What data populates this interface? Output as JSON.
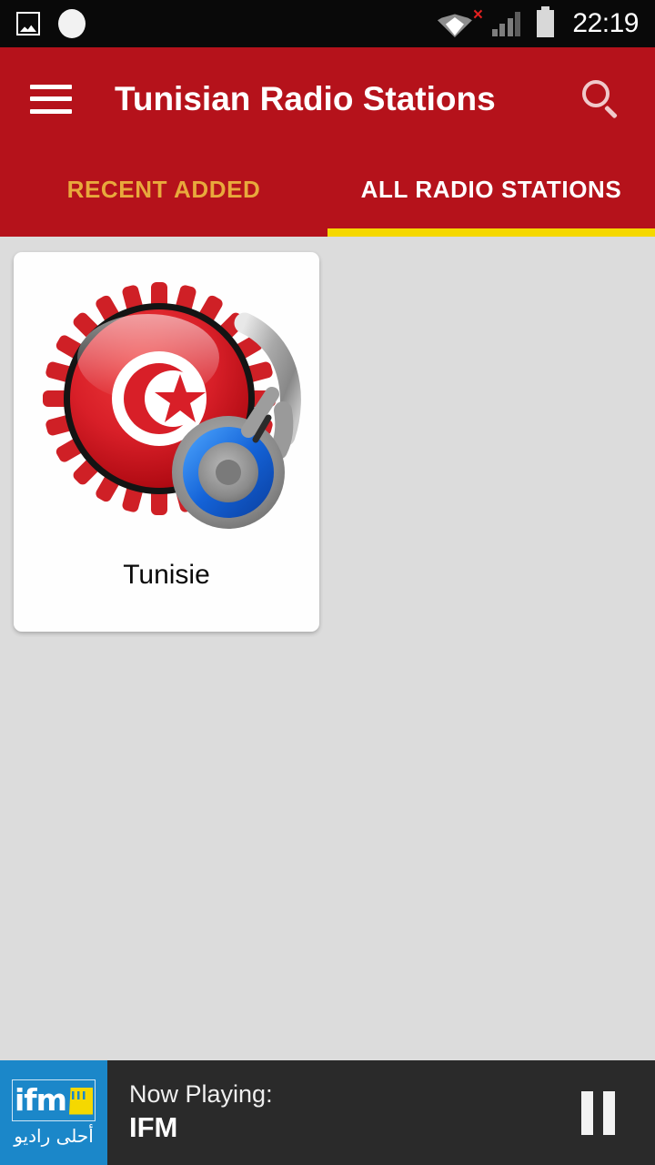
{
  "status_bar": {
    "icons_left": [
      "screenshot-icon",
      "notification-circle-icon"
    ],
    "icons_right": [
      "wifi-vpn-icon",
      "signal-bars-icon",
      "battery-icon"
    ],
    "error_mark": "×",
    "time": "22:19"
  },
  "app_bar": {
    "menu_icon": "hamburger-menu-icon",
    "title": "Tunisian Radio Stations",
    "search_icon": "search-icon"
  },
  "tabs": [
    {
      "label": "RECENT ADDED",
      "active": false
    },
    {
      "label": "ALL RADIO STATIONS",
      "active": true
    }
  ],
  "stations": [
    {
      "name": "Tunisie",
      "art": "tunisia-flag-headphones-icon"
    }
  ],
  "player": {
    "logo_text": "ifm",
    "logo_arabic": "أحلى راديو",
    "now_playing_label": "Now Playing:",
    "station": "IFM",
    "control_icon": "pause-icon"
  },
  "colors": {
    "primary_red": "#b5121b",
    "tab_indicator_yellow": "#f5d800",
    "tab_inactive_gold": "#e8a93c",
    "background_gray": "#dcdcdc",
    "player_dark": "#2a2a2a",
    "logo_blue": "#1b87c9",
    "status_black": "#090909"
  }
}
